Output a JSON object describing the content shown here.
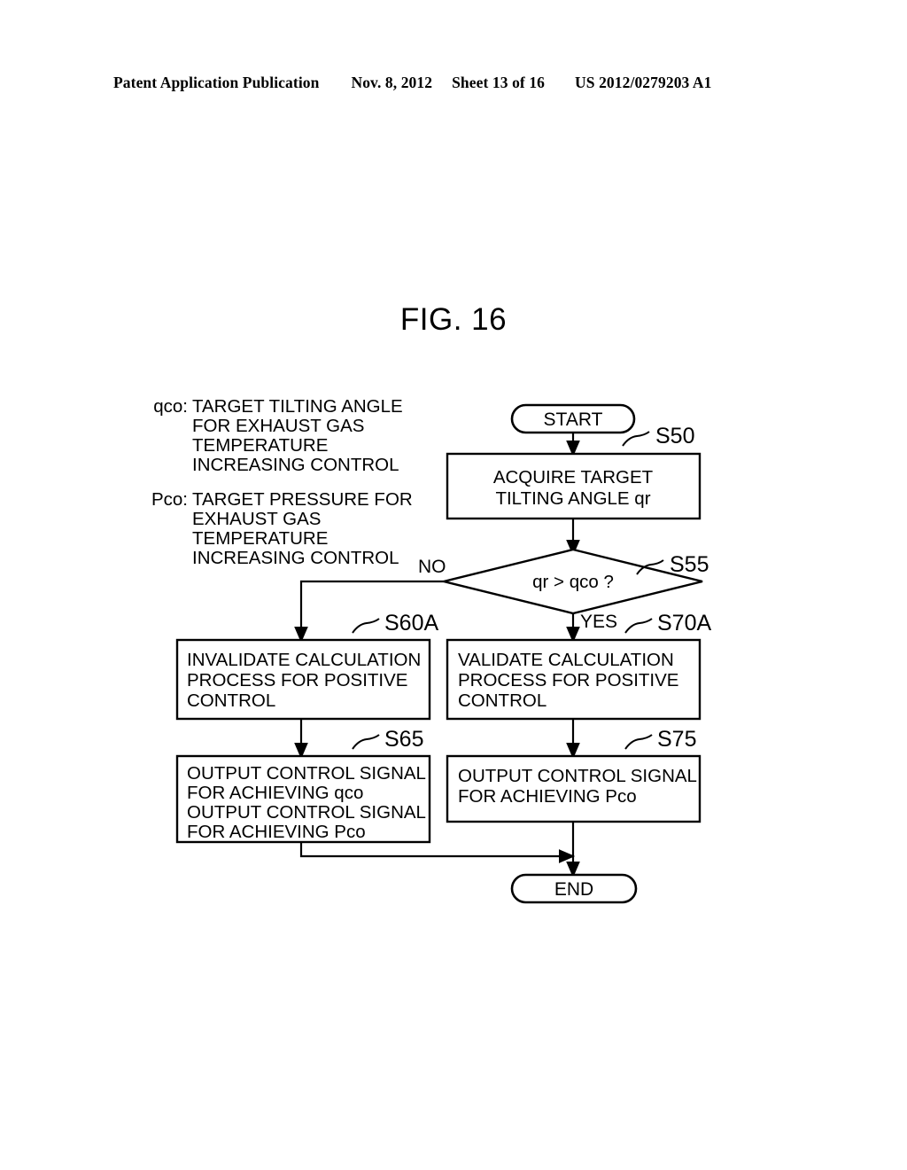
{
  "header": {
    "publication": "Patent Application Publication",
    "date": "Nov. 8, 2012",
    "sheet": "Sheet 13 of 16",
    "number": "US 2012/0279203 A1"
  },
  "figure": {
    "title": "FIG. 16"
  },
  "legend": {
    "entries": [
      {
        "key": "qco:",
        "lines": [
          "TARGET TILTING ANGLE",
          "FOR EXHAUST GAS",
          "TEMPERATURE",
          "INCREASING CONTROL"
        ]
      },
      {
        "key": "Pco:",
        "lines": [
          "TARGET PRESSURE FOR",
          "EXHAUST GAS",
          "TEMPERATURE",
          "INCREASING CONTROL"
        ]
      }
    ]
  },
  "flowchart": {
    "start_label": "START",
    "end_label": "END",
    "branch_no": "NO",
    "branch_yes": "YES",
    "decision": {
      "step": "S55",
      "text": "qr > qco ?"
    },
    "nodes": [
      {
        "step": "S50",
        "align": "center",
        "lines": [
          "ACQUIRE TARGET",
          "TILTING ANGLE qr"
        ]
      },
      {
        "step": "S60A",
        "align": "left",
        "lines": [
          "INVALIDATE CALCULATION",
          "PROCESS FOR POSITIVE",
          "CONTROL"
        ]
      },
      {
        "step": "S70A",
        "align": "left",
        "lines": [
          "VALIDATE CALCULATION",
          "PROCESS FOR POSITIVE",
          "CONTROL"
        ]
      },
      {
        "step": "S65",
        "align": "left",
        "lines": [
          "OUTPUT CONTROL SIGNAL",
          "FOR ACHIEVING qco",
          "OUTPUT CONTROL SIGNAL",
          "FOR ACHIEVING Pco"
        ]
      },
      {
        "step": "S75",
        "align": "left",
        "lines": [
          "OUTPUT CONTROL SIGNAL",
          "FOR ACHIEVING Pco"
        ]
      }
    ]
  },
  "colors": {
    "ink": "#000000",
    "paper": "#ffffff"
  }
}
